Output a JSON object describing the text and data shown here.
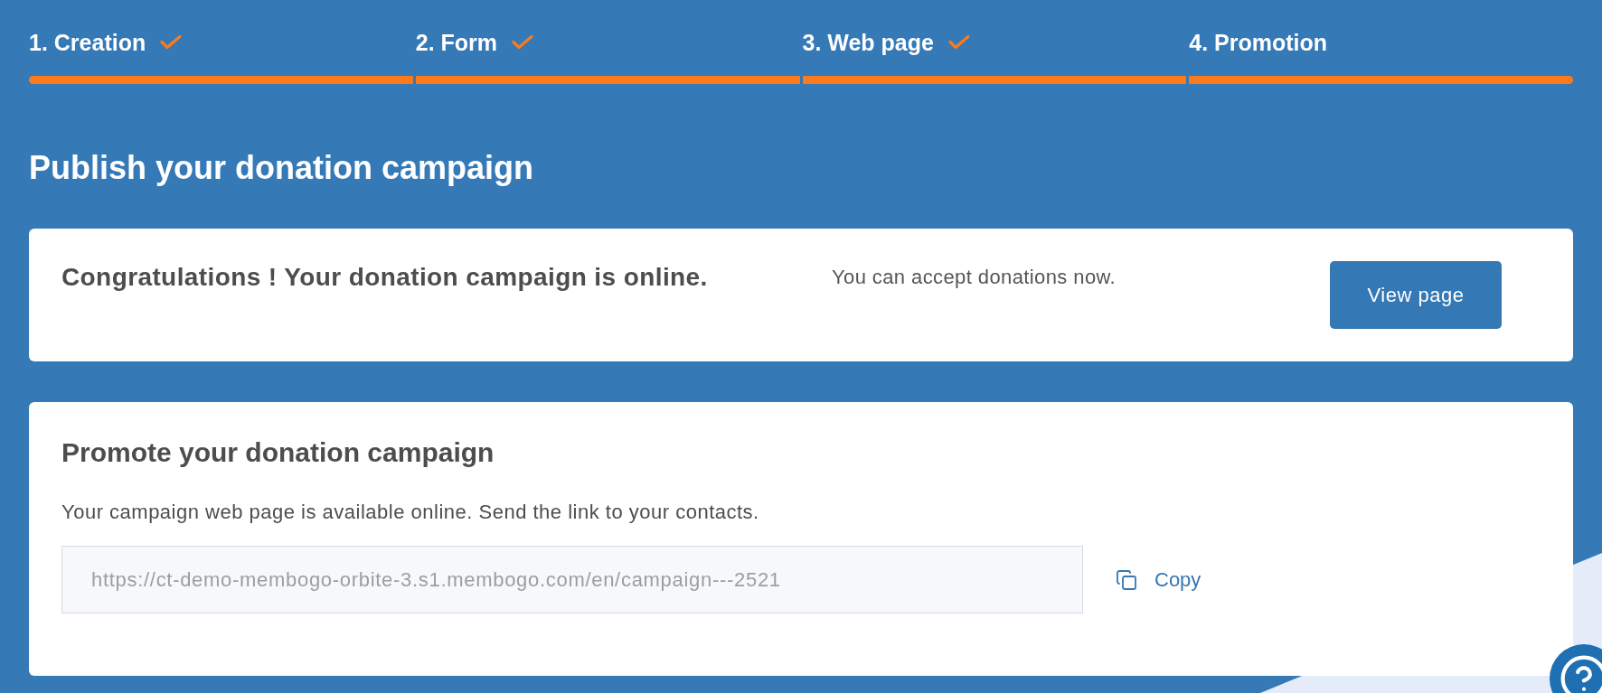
{
  "steps": [
    {
      "label": "1. Creation",
      "done": true
    },
    {
      "label": "2. Form",
      "done": true
    },
    {
      "label": "3. Web page",
      "done": true
    },
    {
      "label": "4. Promotion",
      "done": false
    }
  ],
  "title": "Publish your donation campaign",
  "status_card": {
    "heading": "Congratulations ! Your donation campaign is online.",
    "message": "You can accept donations now.",
    "button": "View page"
  },
  "promote_card": {
    "heading": "Promote your donation campaign",
    "text": "Your campaign web page is available online. Send the link to your contacts.",
    "link_field": {
      "value": "https://ct-demo-membogo-orbite-3.s1.membogo.com/en/campaign---2521"
    },
    "copy_button": "Copy"
  }
}
